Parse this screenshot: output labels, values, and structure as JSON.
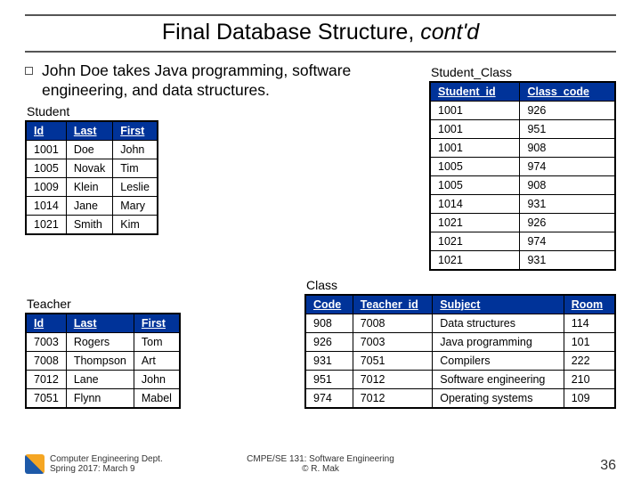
{
  "title_main": "Final Database Structure, ",
  "title_ital": "cont'd",
  "bullet_text": "John Doe takes Java programming, software engineering, and data structures.",
  "labels": {
    "student": "Student",
    "teacher": "Teacher",
    "student_class": "Student_Class",
    "class": "Class"
  },
  "student": {
    "headers": [
      "Id",
      "Last",
      "First"
    ],
    "rows": [
      [
        "1001",
        "Doe",
        "John"
      ],
      [
        "1005",
        "Novak",
        "Tim"
      ],
      [
        "1009",
        "Klein",
        "Leslie"
      ],
      [
        "1014",
        "Jane",
        "Mary"
      ],
      [
        "1021",
        "Smith",
        "Kim"
      ]
    ]
  },
  "teacher": {
    "headers": [
      "Id",
      "Last",
      "First"
    ],
    "rows": [
      [
        "7003",
        "Rogers",
        "Tom"
      ],
      [
        "7008",
        "Thompson",
        "Art"
      ],
      [
        "7012",
        "Lane",
        "John"
      ],
      [
        "7051",
        "Flynn",
        "Mabel"
      ]
    ]
  },
  "student_class": {
    "headers": [
      "Student_id",
      "Class_code"
    ],
    "rows": [
      [
        "1001",
        "926"
      ],
      [
        "1001",
        "951"
      ],
      [
        "1001",
        "908"
      ],
      [
        "1005",
        "974"
      ],
      [
        "1005",
        "908"
      ],
      [
        "1014",
        "931"
      ],
      [
        "1021",
        "926"
      ],
      [
        "1021",
        "974"
      ],
      [
        "1021",
        "931"
      ]
    ]
  },
  "class": {
    "headers": [
      "Code",
      "Teacher_id",
      "Subject",
      "Room"
    ],
    "rows": [
      [
        "908",
        "7008",
        "Data structures",
        "114"
      ],
      [
        "926",
        "7003",
        "Java programming",
        "101"
      ],
      [
        "931",
        "7051",
        "Compilers",
        "222"
      ],
      [
        "951",
        "7012",
        "Software engineering",
        "210"
      ],
      [
        "974",
        "7012",
        "Operating systems",
        "109"
      ]
    ]
  },
  "footer": {
    "left1": "Computer Engineering Dept.",
    "left2": "Spring 2017: March 9",
    "center1": "CMPE/SE 131: Software Engineering",
    "center2": "© R. Mak",
    "pagenum": "36",
    "logo_alt": "SJSU"
  }
}
